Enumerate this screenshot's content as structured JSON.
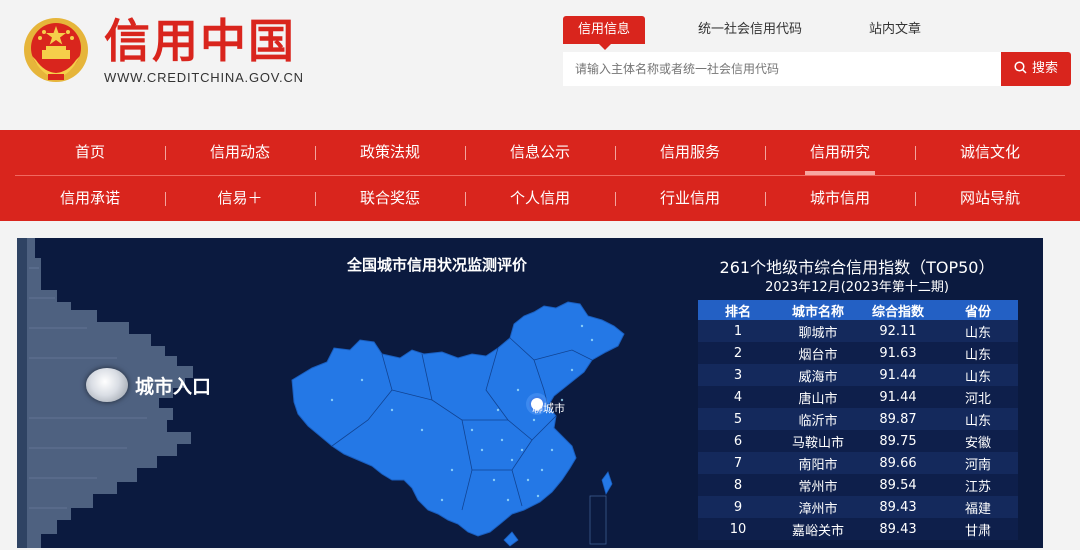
{
  "header": {
    "brand_title": "信用中国",
    "brand_url": "WWW.CREDITCHINA.GOV.CN",
    "search_tabs": [
      "信用信息",
      "统一社会信用代码",
      "站内文章"
    ],
    "search_placeholder": "请输入主体名称或者统一社会信用代码",
    "search_button": "搜索"
  },
  "nav": {
    "row1": [
      "首页",
      "信用动态",
      "政策法规",
      "信息公示",
      "信用服务",
      "信用研究",
      "诚信文化"
    ],
    "row2": [
      "信用承诺",
      "信易＋",
      "联合奖惩",
      "个人信用",
      "行业信用",
      "城市信用",
      "网站导航"
    ],
    "active": "信用研究"
  },
  "panel": {
    "entry_label": "城市入口",
    "map_title": "全国城市信用状况监测评价",
    "map_city": "聊城市",
    "ranking_title": "261个地级市综合信用指数（TOP50）",
    "ranking_subtitle": "2023年12月(2023年第十二期)",
    "table_headers": [
      "排名",
      "城市名称",
      "综合指数",
      "省份"
    ],
    "table_rows": [
      [
        "1",
        "聊城市",
        "92.11",
        "山东"
      ],
      [
        "2",
        "烟台市",
        "91.63",
        "山东"
      ],
      [
        "3",
        "威海市",
        "91.44",
        "山东"
      ],
      [
        "4",
        "唐山市",
        "91.44",
        "河北"
      ],
      [
        "5",
        "临沂市",
        "89.87",
        "山东"
      ],
      [
        "6",
        "马鞍山市",
        "89.75",
        "安徽"
      ],
      [
        "7",
        "南阳市",
        "89.66",
        "河南"
      ],
      [
        "8",
        "常州市",
        "89.54",
        "江苏"
      ],
      [
        "9",
        "漳州市",
        "89.43",
        "福建"
      ],
      [
        "10",
        "嘉峪关市",
        "89.43",
        "甘肃"
      ]
    ]
  },
  "colors": {
    "brand_red": "#d9251d",
    "panel_bg": "#0b1a3f",
    "map_blue": "#2478e6",
    "table_header": "#2360c4"
  }
}
